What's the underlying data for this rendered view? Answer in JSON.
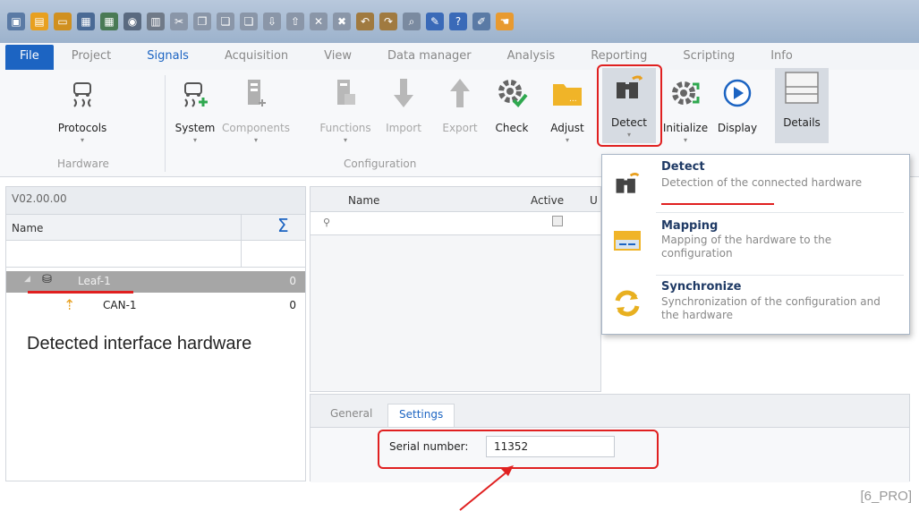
{
  "menu": {
    "tabs": [
      "File",
      "Project",
      "Signals",
      "Acquisition",
      "View",
      "Data manager",
      "Analysis",
      "Reporting",
      "Scripting",
      "Info"
    ],
    "active": "Signals"
  },
  "ribbon": {
    "groups": {
      "hardware": "Hardware",
      "configuration": "Configuration"
    },
    "buttons": {
      "protocols": "Protocols",
      "system": "System",
      "components": "Components",
      "functions": "Functions",
      "import": "Import",
      "export": "Export",
      "check": "Check",
      "adjust": "Adjust",
      "detect": "Detect",
      "initialize": "Initialize",
      "display": "Display",
      "details": "Details"
    }
  },
  "dropdown": {
    "items": [
      {
        "title": "Detect",
        "desc": "Detection of the connected hardware",
        "icon": "binoculars-icon"
      },
      {
        "title": "Mapping",
        "desc": "Mapping of the hardware to the configuration",
        "icon": "mapping-icon"
      },
      {
        "title": "Synchronize",
        "desc": "Synchronization of the configuration and the hardware",
        "icon": "sync-icon"
      }
    ]
  },
  "left_panel": {
    "version": "V02.00.00",
    "column_name": "Name",
    "rows": [
      {
        "name": "Leaf-1",
        "value": "0"
      },
      {
        "name": "CAN-1",
        "value": "0"
      }
    ]
  },
  "grid": {
    "columns": [
      "Name",
      "Active",
      "U"
    ]
  },
  "bottom": {
    "tabs": [
      "General",
      "Settings"
    ],
    "active_tab": "Settings",
    "serial_label": "Serial number:",
    "serial_value": "11352"
  },
  "annotation": {
    "caption": "Detected interface hardware",
    "footnote": "[6_PRO]"
  },
  "colors": {
    "accent": "#1c64c2",
    "highlight": "#e02020"
  }
}
